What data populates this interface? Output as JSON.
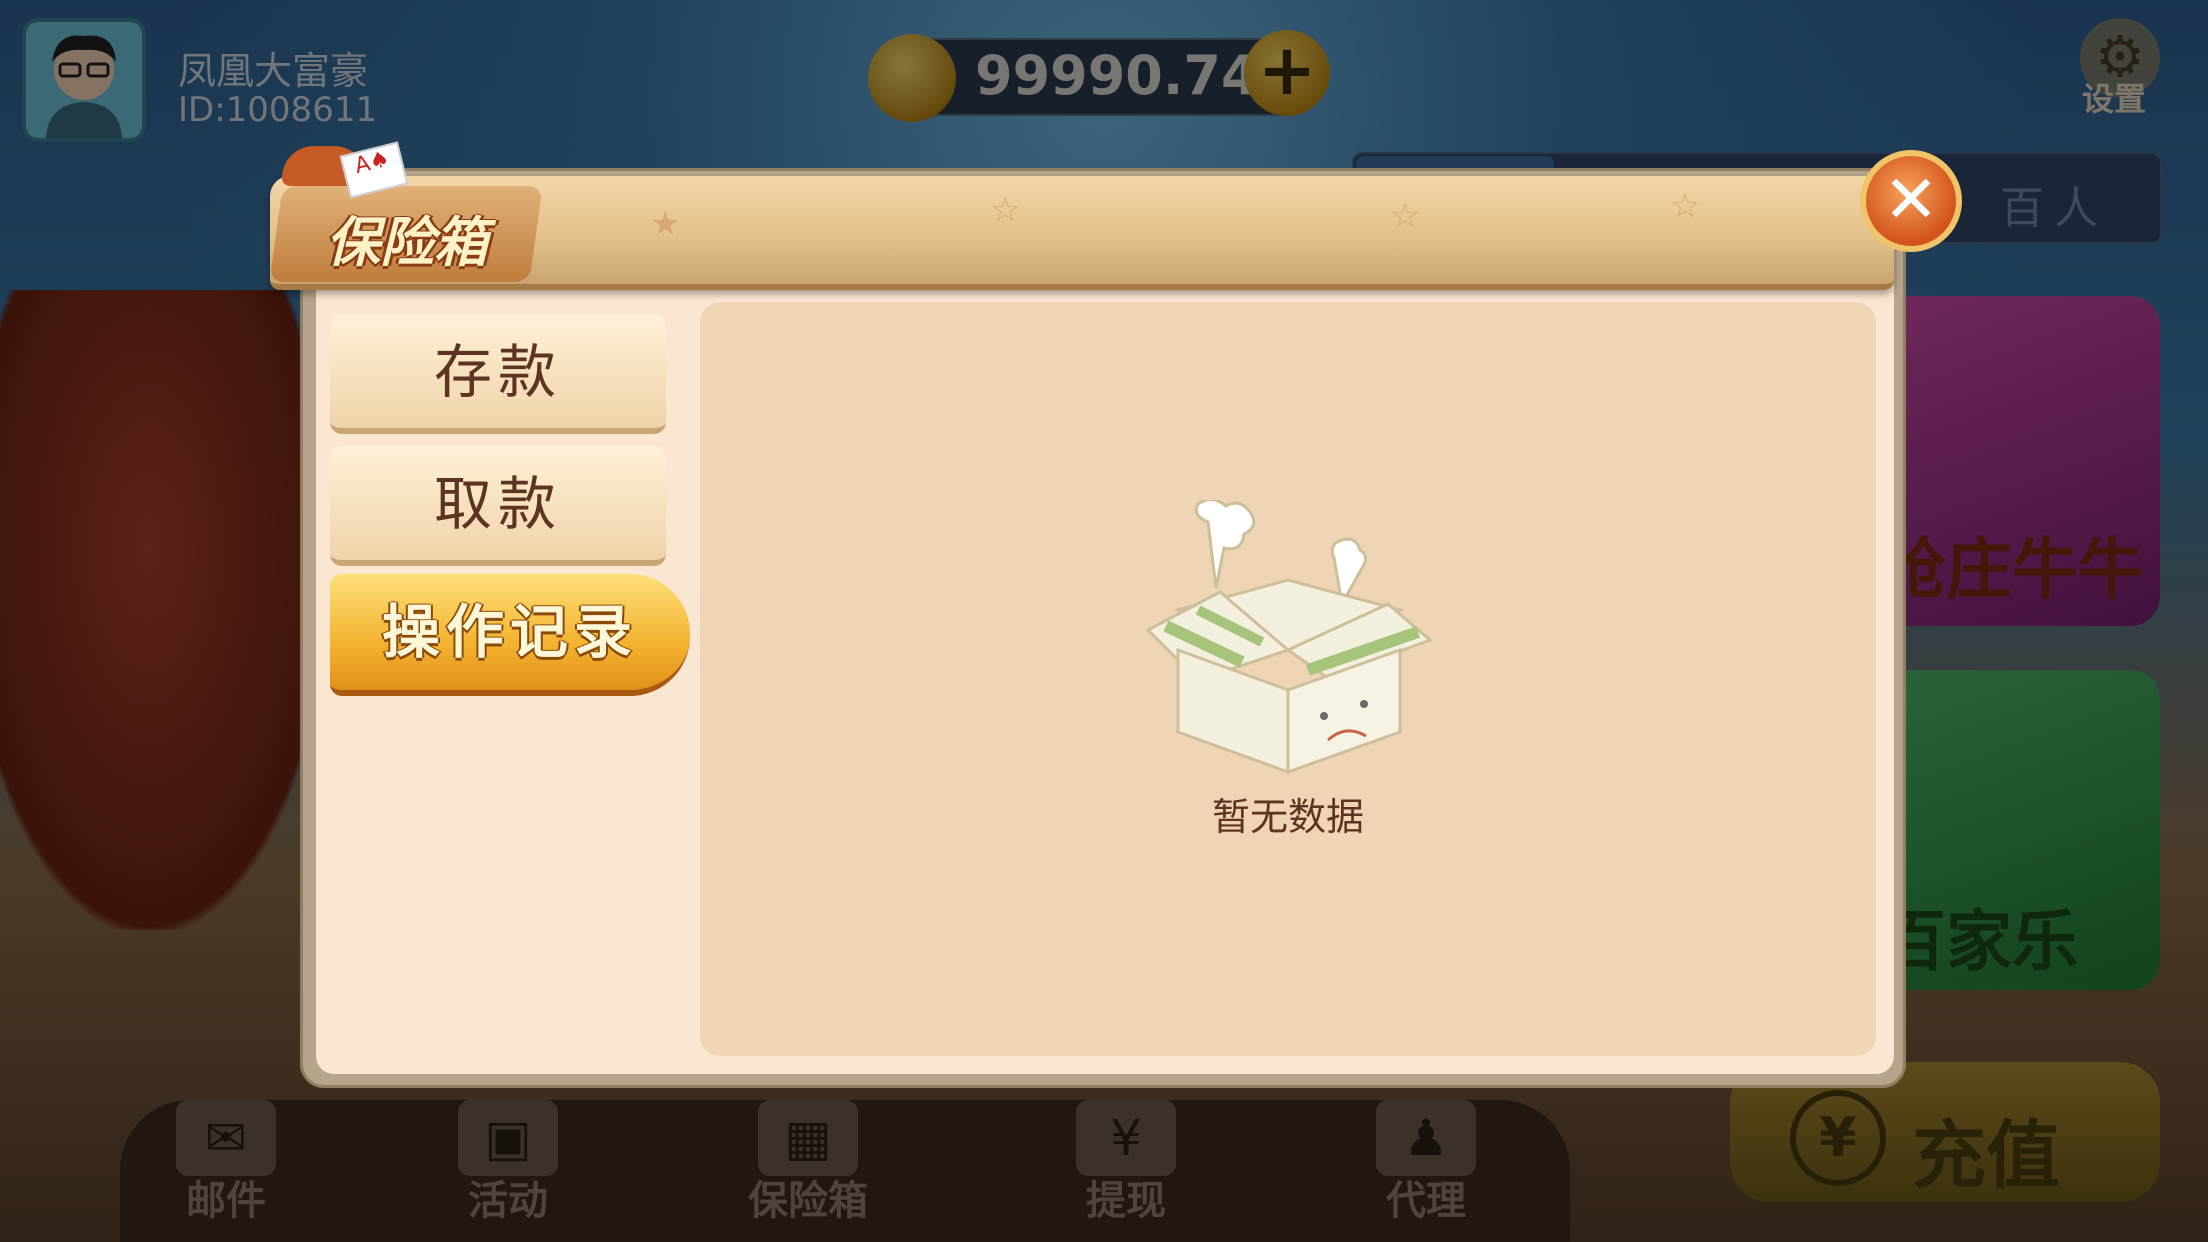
{
  "player": {
    "nickname": "凤凰大富豪",
    "id": "ID:1008611"
  },
  "balance": {
    "coins": "99990.74",
    "add_symbol": "+"
  },
  "settings": {
    "label": "设置"
  },
  "lobby": {
    "top_tab": "百人",
    "games": [
      "抢庄牛牛",
      "百家乐"
    ]
  },
  "bottom_nav": [
    {
      "label": "邮件",
      "icon": "mail-icon",
      "glyph": "✉"
    },
    {
      "label": "活动",
      "icon": "gift-icon",
      "glyph": "🎁"
    },
    {
      "label": "保险箱",
      "icon": "safe-icon",
      "glyph": "▦"
    },
    {
      "label": "提现",
      "icon": "withdraw-icon",
      "glyph": "¥"
    },
    {
      "label": "代理",
      "icon": "agent-icon",
      "glyph": "👤"
    }
  ],
  "recharge": {
    "label": "充值",
    "symbol": "¥"
  },
  "modal": {
    "title": "保险箱",
    "close_symbol": "✕",
    "tabs": [
      {
        "label": "存款",
        "active": false
      },
      {
        "label": "取款",
        "active": false
      },
      {
        "label": "操作记录",
        "active": true
      }
    ],
    "empty_text": "暂无数据"
  },
  "colors": {
    "accent_gold": "#f4b330",
    "panel_bg": "#fbe6d1",
    "content_bg": "#efd5b5",
    "text_brown": "#5d3424"
  }
}
